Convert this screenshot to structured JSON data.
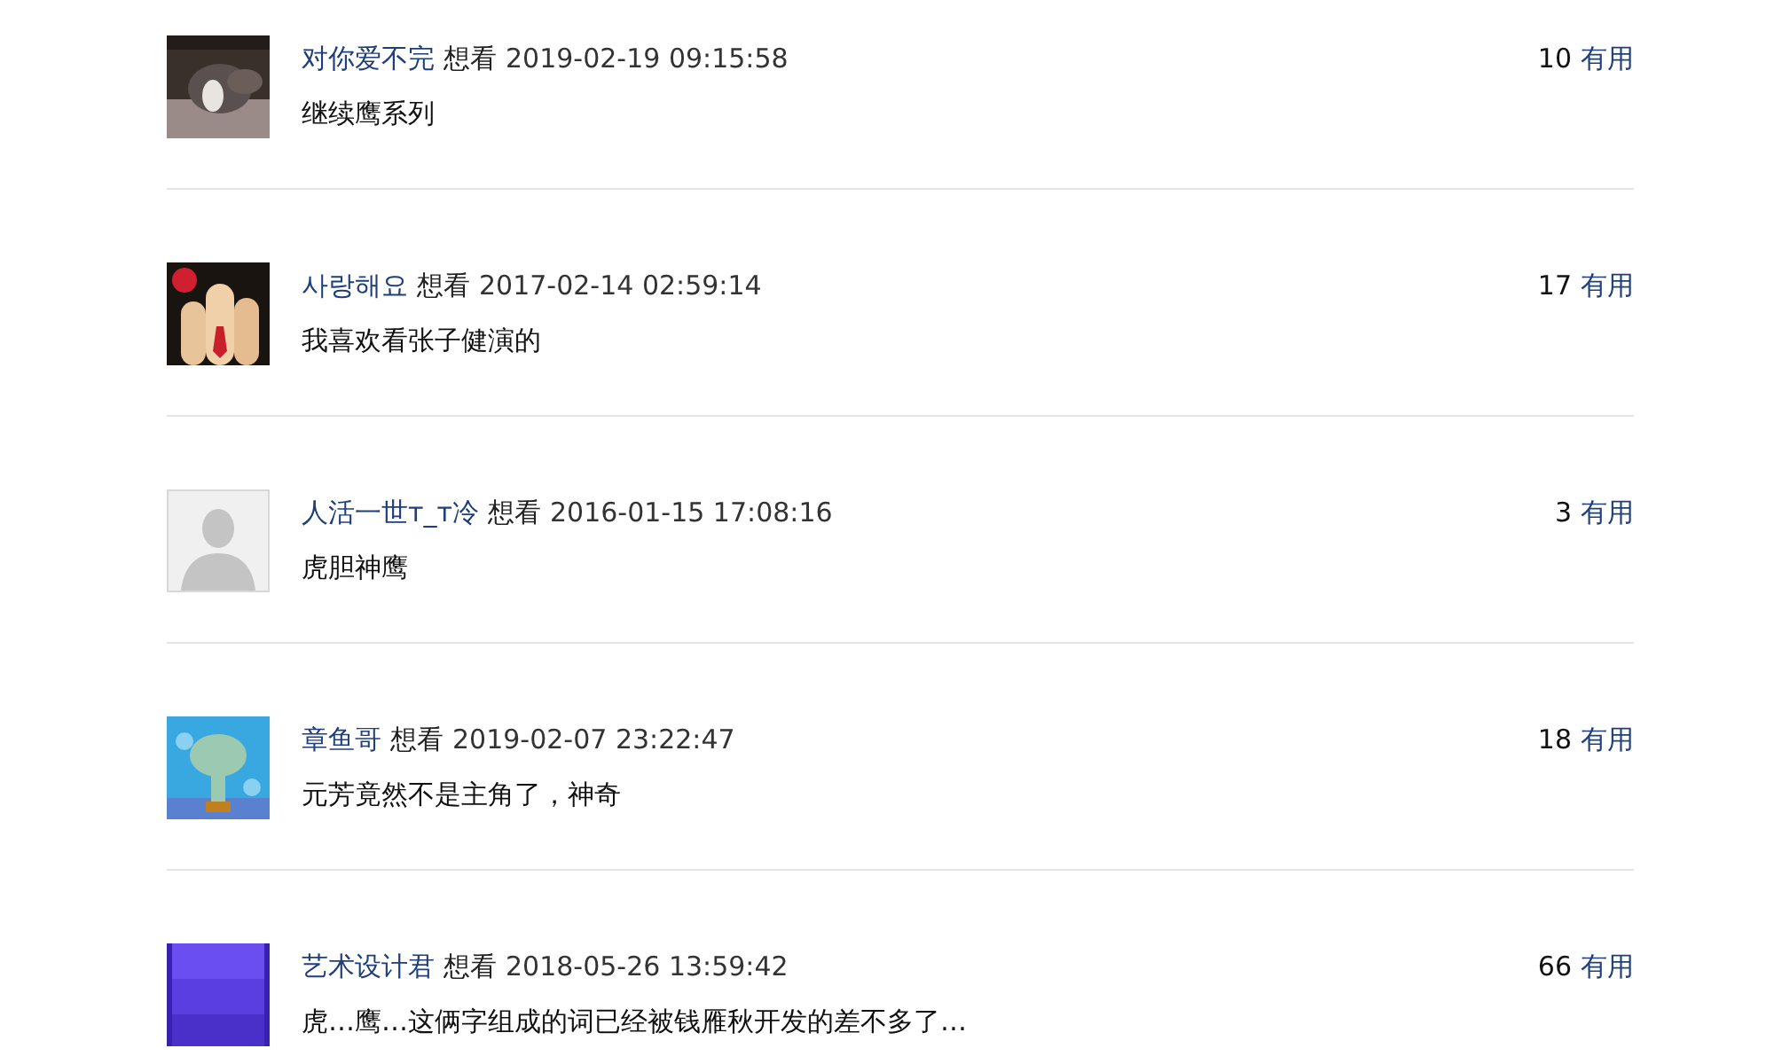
{
  "comments": [
    {
      "user": "对你爱不完",
      "action": "想看",
      "time": "2019-02-19 09:15:58",
      "votes": "10",
      "vote_label": "有用",
      "text": "继续鹰系列"
    },
    {
      "user": "사랑해요",
      "action": "想看",
      "time": "2017-02-14 02:59:14",
      "votes": "17",
      "vote_label": "有用",
      "text": "我喜欢看张子健演的"
    },
    {
      "avatar": {
        "kind": "default"
      },
      "user": "人活一世т_т冷",
      "action": "想看",
      "time": "2016-01-15 17:08:16",
      "votes": "3",
      "vote_label": "有用",
      "text": "虎胆神鹰"
    },
    {
      "user": "章鱼哥",
      "action": "想看",
      "time": "2019-02-07 23:22:47",
      "votes": "18",
      "vote_label": "有用",
      "text": "元芳竟然不是主角了，神奇"
    },
    {
      "user": "艺术设计君",
      "action": "想看",
      "time": "2018-05-26 13:59:42",
      "votes": "66",
      "vote_label": "有用",
      "text": "虎…鹰…这俩字组成的词已经被钱雁秋开发的差不多了…"
    }
  ]
}
